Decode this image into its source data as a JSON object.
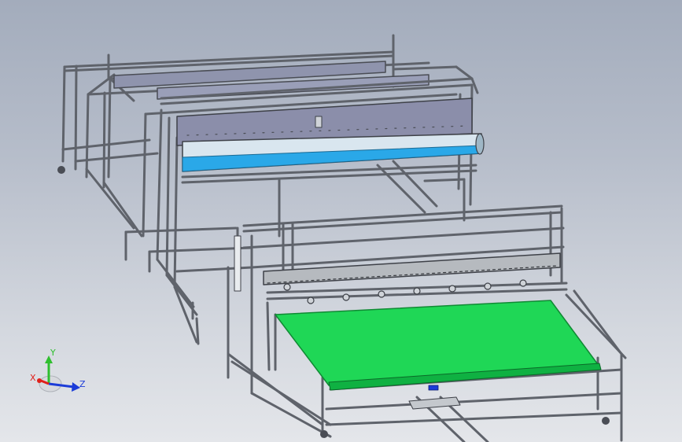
{
  "view": {
    "colors": {
      "background_top": "#a3acbc",
      "background_bottom": "#e4e6ea",
      "frame_metal": "#6f737b",
      "frame_dark": "#3c3f45",
      "belt": "#1fd756",
      "roller_blue": "#2aa8e8",
      "panel": "#8c8fae"
    }
  },
  "triad": {
    "x_label": "X",
    "y_label": "Y",
    "z_label": "Z",
    "x_color": "#e0201a",
    "y_color": "#2fbf2f",
    "z_color": "#1c3cd8"
  }
}
